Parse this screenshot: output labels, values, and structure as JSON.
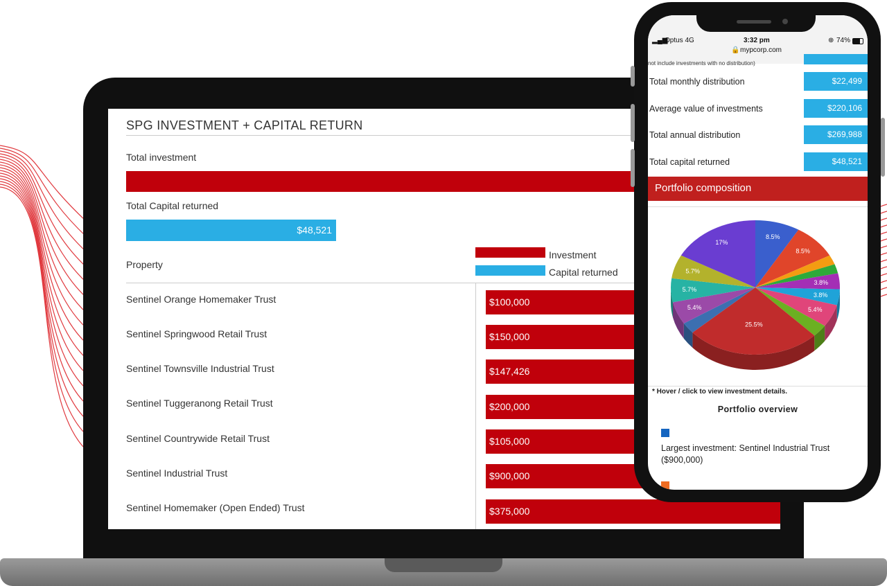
{
  "laptop": {
    "section_title": "SPG INVESTMENT + CAPITAL RETURN",
    "total_investment_label": "Total investment",
    "total_capital_label": "Total Capital returned",
    "total_capital_value": "$48,521",
    "property_header": "Property",
    "legend": {
      "investment": "Investment",
      "capital": "Capital returned"
    },
    "properties": [
      {
        "name": "Sentinel Orange Homemaker Trust",
        "investment": "$100,000"
      },
      {
        "name": "Sentinel Springwood Retail Trust",
        "investment": "$150,000"
      },
      {
        "name": "Sentinel Townsville Industrial Trust",
        "investment": "$147,426"
      },
      {
        "name": "Sentinel Tuggeranong Retail Trust",
        "investment": "$200,000"
      },
      {
        "name": "Sentinel Countrywide Retail Trust",
        "investment": "$105,000"
      },
      {
        "name": "Sentinel Industrial Trust",
        "investment": "$900,000"
      },
      {
        "name": "Sentinel Homemaker (Open Ended) Trust",
        "investment": "$375,000"
      }
    ]
  },
  "phone": {
    "status": {
      "carrier": "Optus 4G",
      "time": "3:32 pm",
      "battery": "74%",
      "url": "mypcorp.com"
    },
    "cut_off_note": "not include investments with no distribution)",
    "stats": [
      {
        "label": "Total monthly distribution",
        "value": "$22,499"
      },
      {
        "label": "Average value of investments",
        "value": "$220,106"
      },
      {
        "label": "Total annual distribution",
        "value": "$269,988"
      },
      {
        "label": "Total capital returned",
        "value": "$48,521"
      }
    ],
    "portfolio_header": "Portfolio composition",
    "hover_note": "* Hover / click to view investment details.",
    "overview_title": "Portfolio overview",
    "largest_investment": "Largest investment: Sentinel Industrial Trust ($900,000)"
  },
  "chart_data": {
    "type": "pie",
    "slices": [
      {
        "label": "8.5%",
        "value": 8.5,
        "color": "#3a5fcd"
      },
      {
        "label": "8.5%",
        "value": 8.5,
        "color": "#e0452a"
      },
      {
        "label": "",
        "value": 2.3,
        "color": "#f39c12"
      },
      {
        "label": "",
        "value": 2.2,
        "color": "#2eaa3a"
      },
      {
        "label": "3.8%",
        "value": 3.8,
        "color": "#a42fb5"
      },
      {
        "label": "3.8%",
        "value": 3.8,
        "color": "#1fa3d8"
      },
      {
        "label": "5.4%",
        "value": 5.4,
        "color": "#e0457a"
      },
      {
        "label": "",
        "value": 3.0,
        "color": "#6bb022"
      },
      {
        "label": "25.5%",
        "value": 25.5,
        "color": "#c02c2c"
      },
      {
        "label": "",
        "value": 2.7,
        "color": "#3c6fb0"
      },
      {
        "label": "5.4%",
        "value": 5.4,
        "color": "#9b4aa8"
      },
      {
        "label": "5.7%",
        "value": 5.7,
        "color": "#27b3a4"
      },
      {
        "label": "5.7%",
        "value": 5.7,
        "color": "#b3b22c"
      },
      {
        "label": "17%",
        "value": 17,
        "color": "#6a3dd1"
      }
    ]
  }
}
